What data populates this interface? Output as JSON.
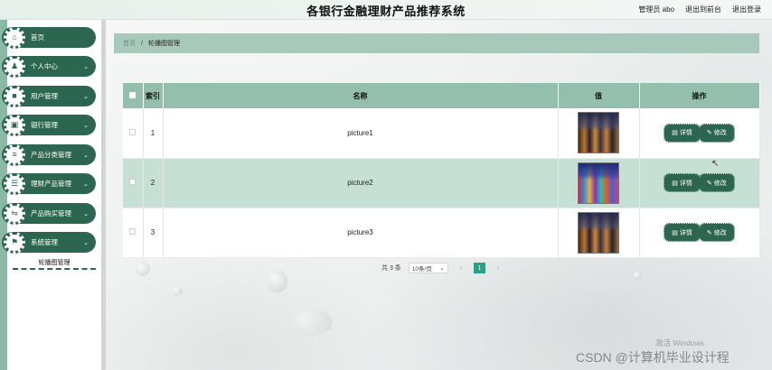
{
  "header": {
    "title": "各银行金融理财产品推荐系统",
    "links": [
      "管理员 abo",
      "退出到前台",
      "退出登录"
    ]
  },
  "sidebar": {
    "items": [
      {
        "label": "首页",
        "icon": "home-icon",
        "glyph": "⌂",
        "has_arrow": false
      },
      {
        "label": "个人中心",
        "icon": "person-icon",
        "glyph": "♟",
        "has_arrow": true
      },
      {
        "label": "用户管理",
        "icon": "user-icon",
        "glyph": "■",
        "has_arrow": true
      },
      {
        "label": "银行管理",
        "icon": "bank-icon",
        "glyph": "▣",
        "has_arrow": true
      },
      {
        "label": "产品分类管理",
        "icon": "category-icon",
        "glyph": "≡",
        "has_arrow": true
      },
      {
        "label": "理财产品管理",
        "icon": "product-icon",
        "glyph": "☰",
        "has_arrow": true
      },
      {
        "label": "产品购买管理",
        "icon": "purchase-icon",
        "glyph": "⇋",
        "has_arrow": true
      },
      {
        "label": "系统管理",
        "icon": "flag-icon",
        "glyph": "⚑",
        "has_arrow": true
      }
    ],
    "submenu_active": "轮播图管理"
  },
  "breadcrumb": {
    "home": "首页",
    "separator": "/",
    "current": "轮播图管理"
  },
  "table": {
    "headers": {
      "index": "索引",
      "name": "名称",
      "value": "值",
      "actions": "操作"
    },
    "rows": [
      {
        "index": "1",
        "name": "picture1",
        "thumb": "night-city",
        "alt": false
      },
      {
        "index": "2",
        "name": "picture2",
        "thumb": "colorful-buildings",
        "alt": true
      },
      {
        "index": "3",
        "name": "picture3",
        "thumb": "night-city",
        "alt": false
      }
    ],
    "detail_label": "详情",
    "edit_label": "修改"
  },
  "pagination": {
    "total": "共 3 条",
    "page_size": "10条/页",
    "current_page": "1"
  },
  "watermark": {
    "windows": "激活 Windows",
    "csdn": "CSDN @计算机毕业设计程"
  },
  "colors": {
    "primary": "#2c6650",
    "header_row": "#93bfac",
    "alt_row": "#c7e0d6",
    "breadcrumb": "#a7c9bb",
    "page_active": "#2aa184"
  }
}
